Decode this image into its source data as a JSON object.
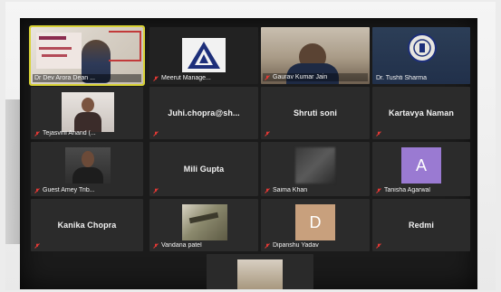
{
  "colors": {
    "active_speaker_border": "#d8d235",
    "muted_icon": "#e53935",
    "tile_background": "#2b2b2b",
    "avatar_purple": "#9a7ad2",
    "avatar_tan": "#c8a07d"
  },
  "participants": [
    {
      "name": "Dr Dev Arora Dean ...",
      "type": "video",
      "active": true,
      "muted": false
    },
    {
      "name": "Meerut Manage...",
      "type": "video",
      "muted": true
    },
    {
      "name": "Gaurav Kumar Jain",
      "type": "video",
      "muted": true
    },
    {
      "name": "Dr. Tushti Sharma",
      "type": "video",
      "muted": false
    },
    {
      "name": "Tejasvini Anand (...",
      "type": "video",
      "muted": true
    },
    {
      "name": "Juhi.chopra@sh...",
      "type": "name_only",
      "muted": true
    },
    {
      "name": "Shruti soni",
      "type": "name_only",
      "muted": true
    },
    {
      "name": "Kartavya Naman",
      "type": "name_only",
      "muted": true
    },
    {
      "name": "Guest Amey Trib...",
      "type": "video",
      "muted": true
    },
    {
      "name": "Mili Gupta",
      "type": "name_only",
      "muted": true
    },
    {
      "name": "Saima Khan",
      "type": "video",
      "muted": true
    },
    {
      "name": "Tanisha Agarwal",
      "type": "avatar",
      "avatar_letter": "A",
      "muted": true
    },
    {
      "name": "Kanika Chopra",
      "type": "name_only",
      "muted": true
    },
    {
      "name": "Vandana patel",
      "type": "video",
      "muted": true
    },
    {
      "name": "Dipanshu Yadav",
      "type": "avatar",
      "avatar_letter": "D",
      "muted": true
    },
    {
      "name": "Redmi",
      "type": "name_only",
      "muted": true
    },
    {
      "name": "",
      "type": "video",
      "muted": false
    }
  ]
}
